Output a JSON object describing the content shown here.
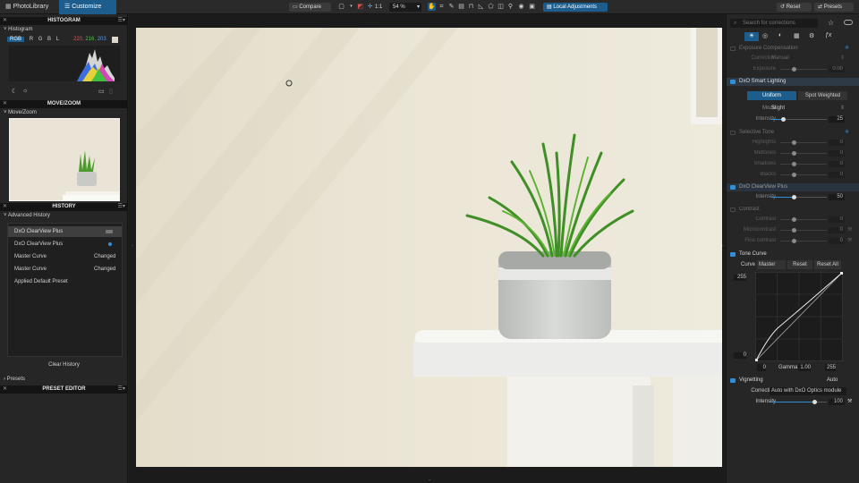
{
  "topbar": {
    "tab_photolibrary": "PhotoLibrary",
    "tab_customize": "Customize",
    "compare": "Compare",
    "zoom_fit": "1:1",
    "zoom_level": "54 %",
    "local_adjustments": "Local Adjustments",
    "reset": "Reset",
    "presets": "Presets"
  },
  "left": {
    "histogram_header": "HISTOGRAM",
    "histogram_sub": "Histogram",
    "channel_rgb": "RGB",
    "channel_r": "R",
    "channel_g": "G",
    "channel_b": "B",
    "channel_l": "L",
    "rgb_r": "220,",
    "rgb_g": "216,",
    "rgb_b": "203",
    "movezoom_header": "MOVE/ZOOM",
    "movezoom_sub": "Move/Zoom",
    "history_header": "HISTORY",
    "advanced_history": "Advanced History",
    "history_items": [
      {
        "name": "DxO ClearView Plus",
        "value": ""
      },
      {
        "name": "DxO ClearView Plus",
        "value": ""
      },
      {
        "name": "Master Curve",
        "value": "Changed"
      },
      {
        "name": "Master Curve",
        "value": "Changed"
      },
      {
        "name": "Applied Default Preset",
        "value": ""
      }
    ],
    "clear_history": "Clear History",
    "presets": "Presets",
    "preset_editor_header": "PRESET EDITOR"
  },
  "right": {
    "search_placeholder": "Search for corrections",
    "exposure_title": "Exposure Compensation",
    "exposure_correction_label": "Correction",
    "exposure_correction_value": "Manual",
    "exposure_label": "Exposure",
    "exposure_value": "0.00",
    "smart_lighting_title": "DxO Smart Lighting",
    "uniform": "Uniform",
    "spot_weighted": "Spot Weighted",
    "mode_label": "Mode",
    "mode_value": "Slight",
    "intensity_label": "Intensity",
    "sl_intensity_value": "25",
    "selective_tone_title": "Selective Tone",
    "highlights_label": "Highlights",
    "highlights_value": "0",
    "midtones_label": "Midtones",
    "midtones_value": "0",
    "shadows_label": "Shadows",
    "shadows_value": "0",
    "blacks_label": "Blacks",
    "blacks_value": "0",
    "clearview_title": "DxO ClearView Plus",
    "cv_intensity_value": "50",
    "contrast_title": "Contrast",
    "contrast_label": "Contrast",
    "contrast_value": "0",
    "microcontrast_label": "Microcontrast",
    "microcontrast_value": "0",
    "finecontrast_label": "Fine contrast",
    "finecontrast_value": "0",
    "tonecurve_title": "Tone Curve",
    "curve_label": "Curve",
    "curve_value": "Master",
    "curve_reset": "Reset",
    "curve_reset_all": "Reset All",
    "curve_top": "255",
    "curve_bottom": "0",
    "curve_in_low": "0",
    "gamma_label": "Gamma",
    "gamma_value": "1.00",
    "curve_in_high": "255",
    "vignetting_title": "Vignetting",
    "vignetting_auto": "Auto",
    "vig_correction_label": "Correction",
    "vig_correction_value": "Auto with DxO Optics module",
    "vig_intensity_label": "Intensity",
    "vig_intensity_value": "100"
  },
  "colors": {
    "accent": "#1c5d8e",
    "highlight": "#2f8fd9"
  }
}
